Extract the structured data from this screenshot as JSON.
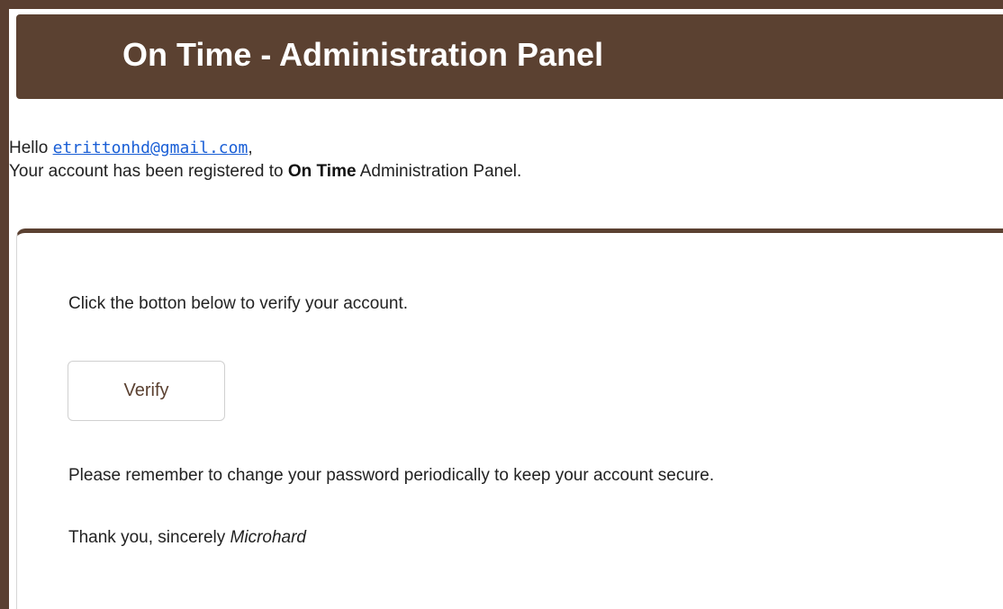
{
  "header": {
    "title": "On Time - Administration Panel"
  },
  "intro": {
    "greeting_prefix": "Hello ",
    "email": "etrittonhd@gmail.com",
    "greeting_suffix": ",",
    "registered_prefix": "Your account has been registered to ",
    "app_name": "On Time",
    "registered_suffix": " Administration Panel."
  },
  "card": {
    "instruction": "Click the botton below to verify your account.",
    "verify_label": "Verify",
    "reminder": "Please remember to change your password periodically to keep your account secure.",
    "thanks_prefix": "Thank you, sincerely ",
    "signature": "Microhard"
  },
  "colors": {
    "outer_background": "#5a3f31",
    "header_background": "#5b4131",
    "link": "#1a5fd6"
  }
}
